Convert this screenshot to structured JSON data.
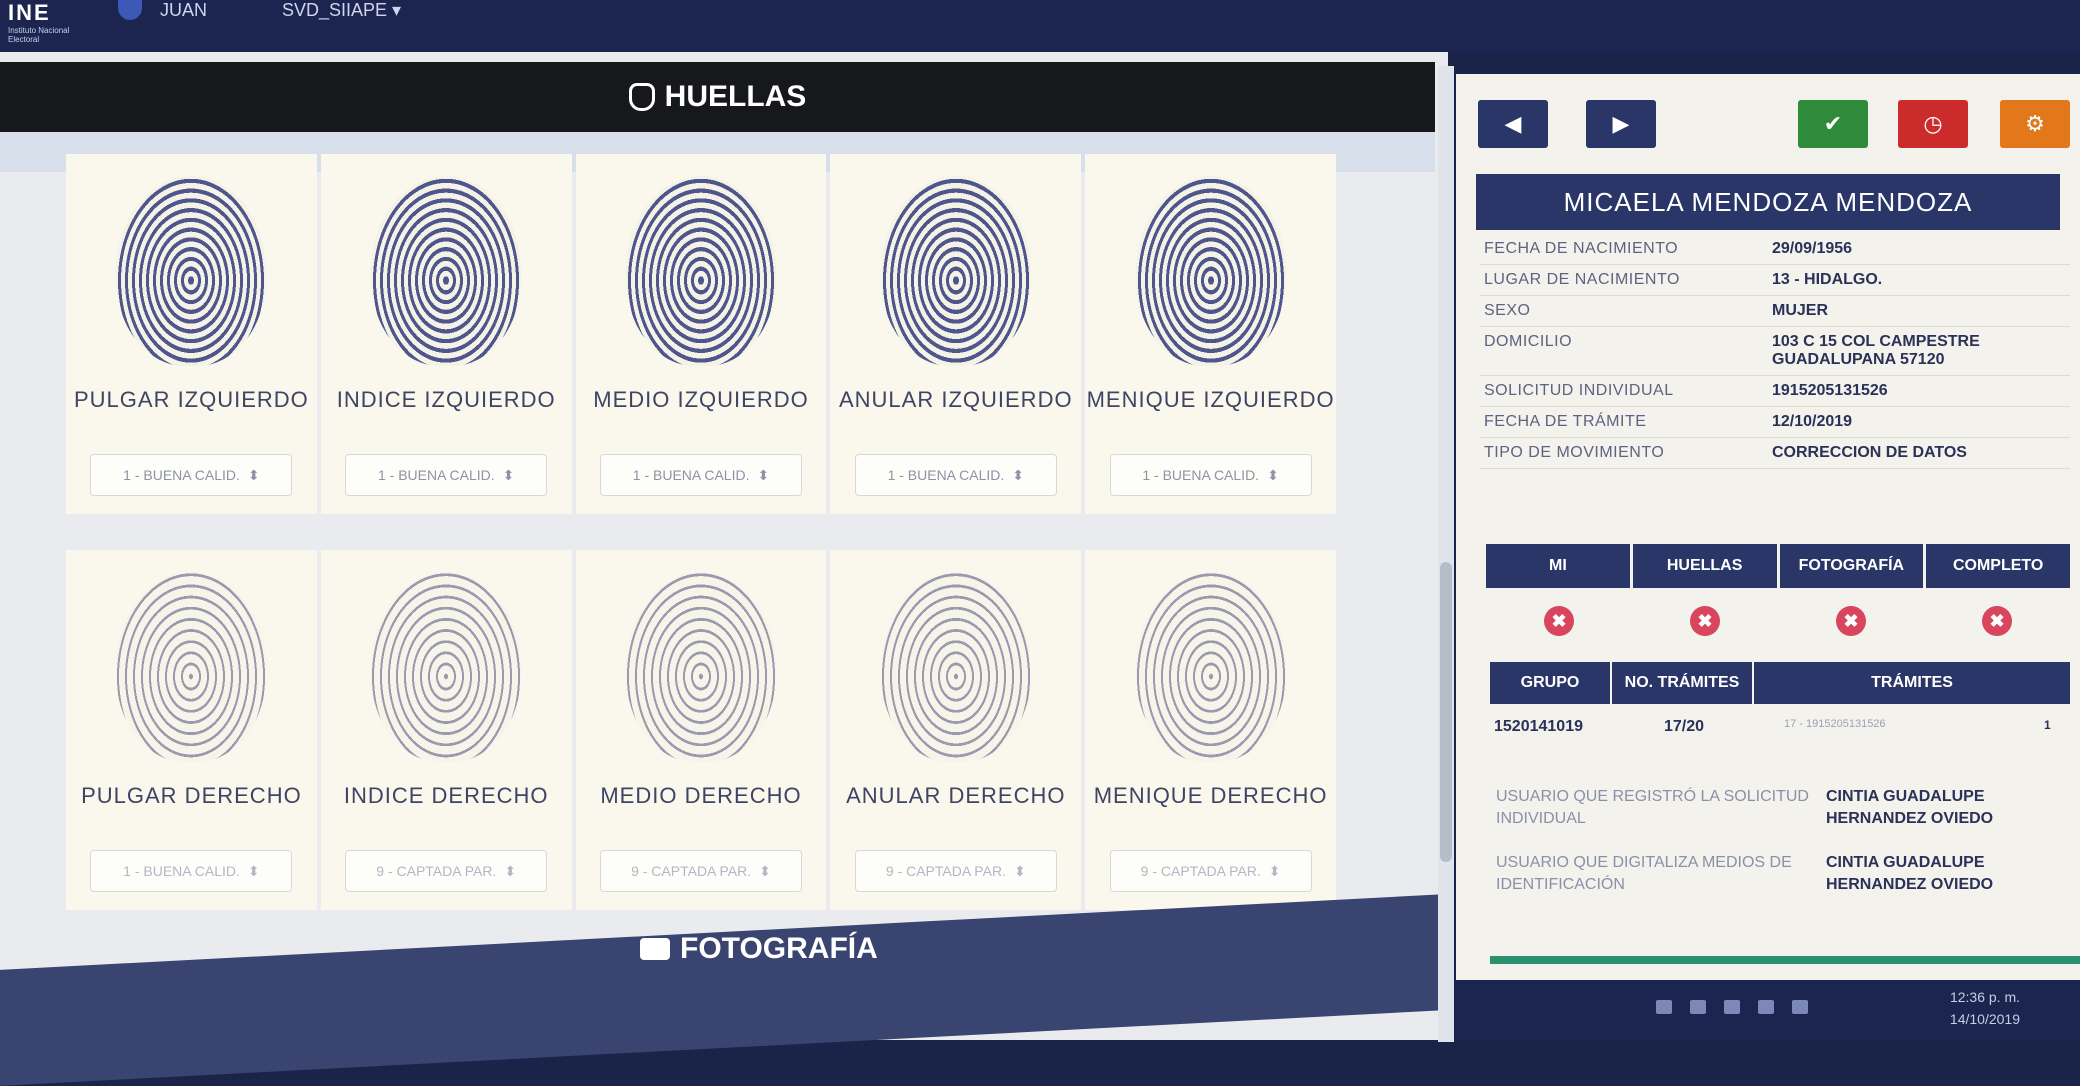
{
  "topbar": {
    "logo": "INE",
    "logo_sub": "Instituto Nacional Electoral",
    "user": "JUAN",
    "system": "SVD_SIIAPE ▾"
  },
  "huellas": {
    "title": "HUELLAS",
    "row1": [
      {
        "name": "PULGAR IZQUIERDO",
        "quality": "1 - BUENA CALID."
      },
      {
        "name": "INDICE IZQUIERDO",
        "quality": "1 - BUENA CALID."
      },
      {
        "name": "MEDIO IZQUIERDO",
        "quality": "1 - BUENA CALID."
      },
      {
        "name": "ANULAR IZQUIERDO",
        "quality": "1 - BUENA CALID."
      },
      {
        "name": "MENIQUE IZQUIERDO",
        "quality": "1 - BUENA CALID."
      }
    ],
    "row2": [
      {
        "name": "PULGAR DERECHO",
        "quality": "1 - BUENA CALID."
      },
      {
        "name": "INDICE DERECHO",
        "quality": "9 - CAPTADA PAR."
      },
      {
        "name": "MEDIO DERECHO",
        "quality": "9 - CAPTADA PAR."
      },
      {
        "name": "ANULAR DERECHO",
        "quality": "9 - CAPTADA PAR."
      },
      {
        "name": "MENIQUE DERECHO",
        "quality": "9 - CAPTADA PAR."
      }
    ]
  },
  "fotografia": {
    "title": "FOTOGRAFÍA"
  },
  "person": {
    "name": "MICAELA MENDOZA MENDOZA",
    "fields": [
      {
        "label": "FECHA DE NACIMIENTO",
        "value": "29/09/1956"
      },
      {
        "label": "LUGAR DE NACIMIENTO",
        "value": "13 - HIDALGO."
      },
      {
        "label": "SEXO",
        "value": "MUJER"
      },
      {
        "label": "DOMICILIO",
        "value": "103 C 15 COL CAMPESTRE GUADALUPANA 57120"
      },
      {
        "label": "SOLICITUD INDIVIDUAL",
        "value": "1915205131526"
      },
      {
        "label": "FECHA DE TRÁMITE",
        "value": "12/10/2019"
      },
      {
        "label": "TIPO DE MOVIMIENTO",
        "value": "CORRECCION DE DATOS"
      }
    ]
  },
  "status": {
    "headers": [
      "MI",
      "HUELLAS",
      "FOTOGRAFÍA",
      "COMPLETO"
    ],
    "icon": "✖"
  },
  "tramites": {
    "headers": [
      "GRUPO",
      "NO. TRÁMITES",
      "TRÁMITES"
    ],
    "grupo": "1520141019",
    "no": "17/20",
    "tramites": "17 - 1915205131526",
    "count": "1"
  },
  "users": [
    {
      "label": "USUARIO QUE REGISTRÓ LA SOLICITUD INDIVIDUAL",
      "value": "CINTIA GUADALUPE HERNANDEZ OVIEDO"
    },
    {
      "label": "USUARIO QUE DIGITALIZA MEDIOS DE IDENTIFICACIÓN",
      "value": "CINTIA GUADALUPE HERNANDEZ OVIEDO"
    }
  ],
  "taskbar": {
    "time": "12:36 p. m.",
    "date": "14/10/2019"
  },
  "colors": {
    "primary": "#2a3568",
    "success": "#2f8a3a",
    "danger": "#cc2b2b",
    "warning": "#e2781a",
    "status_x": "#d8455c"
  }
}
